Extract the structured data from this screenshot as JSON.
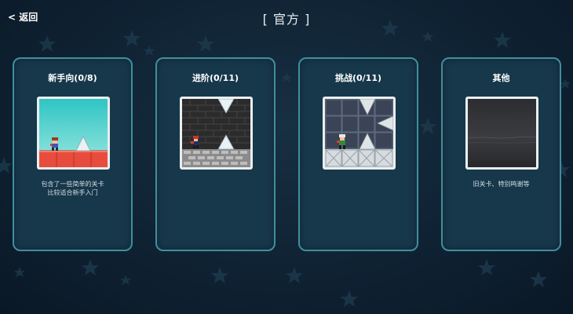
{
  "header": {
    "back_label": "< 返回",
    "title": "[ 官方 ]"
  },
  "cards": [
    {
      "title": "新手向(0/8)",
      "desc_lines": [
        "包含了一些简单的关卡",
        "比较适合新手入门"
      ]
    },
    {
      "title": "进阶(0/11)",
      "desc_lines": []
    },
    {
      "title": "挑战(0/11)",
      "desc_lines": []
    },
    {
      "title": "其他",
      "desc_lines": [
        "旧关卡、特别鸣谢等"
      ]
    }
  ],
  "colors": {
    "background": "#0f2233",
    "card_border": "#3e8fa0",
    "card_fill": "#17384b",
    "thumb_border": "#e9eef0"
  }
}
